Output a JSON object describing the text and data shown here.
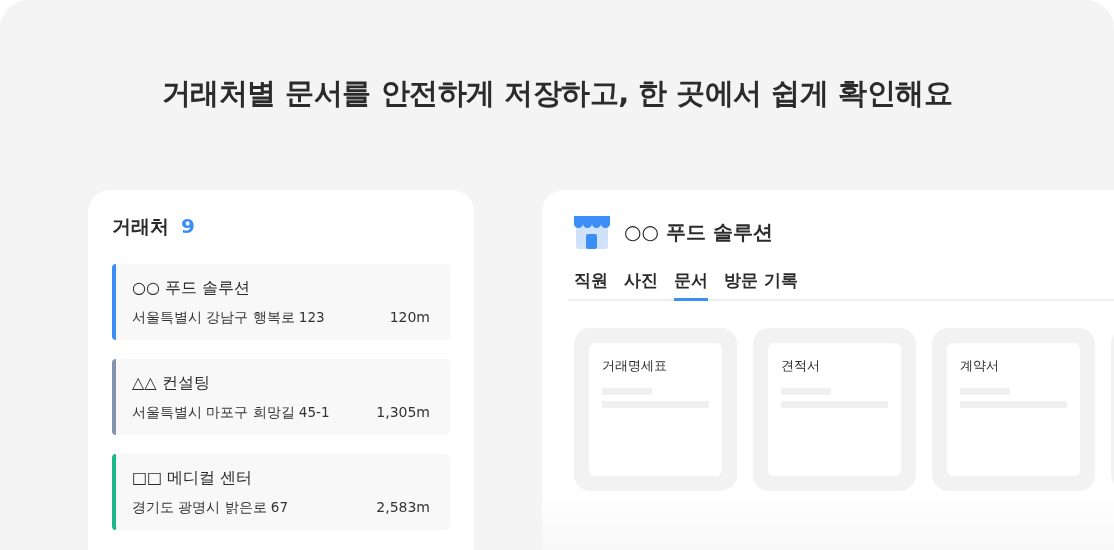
{
  "headline": "거래처별 문서를 안전하게 저장하고, 한 곳에서 쉽게 확인해요",
  "client_list": {
    "title": "거래처",
    "count": "9",
    "items": [
      {
        "name": "○○ 푸드 솔루션",
        "address": "서울특별시 강남구 행복로 123",
        "distance": "120m",
        "color": "#3a8ef6"
      },
      {
        "name": "△△ 컨설팅",
        "address": "서울특별시 마포구 희망길 45-1",
        "distance": "1,305m",
        "color": "#8393ad"
      },
      {
        "name": "□□ 메디컬 센터",
        "address": "경기도 광명시 밝은로 67",
        "distance": "2,583m",
        "color": "#1bb88a"
      }
    ]
  },
  "detail": {
    "title": "○○ 푸드 솔루션",
    "tabs": [
      {
        "label": "직원",
        "selected": false
      },
      {
        "label": "사진",
        "selected": false
      },
      {
        "label": "문서",
        "selected": true
      },
      {
        "label": "방문 기록",
        "selected": false
      }
    ],
    "documents": [
      {
        "title": "거래명세표"
      },
      {
        "title": "견적서"
      },
      {
        "title": "계약서"
      }
    ]
  }
}
